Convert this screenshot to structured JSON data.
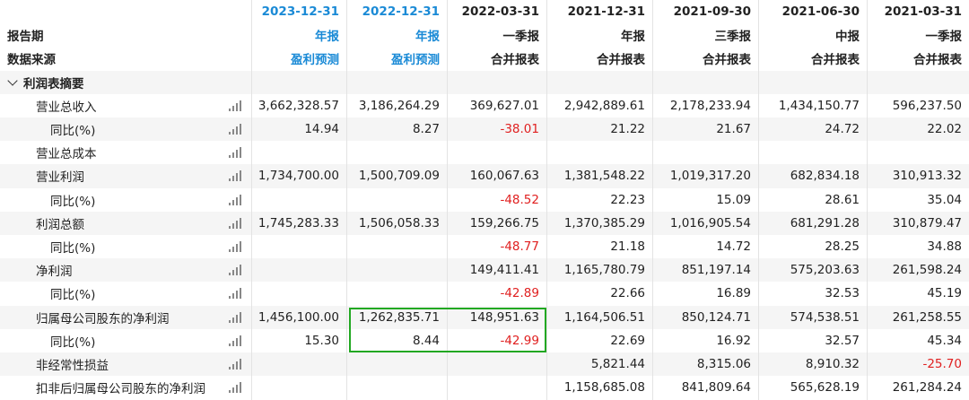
{
  "header": {
    "dates": [
      "2023-12-31",
      "2022-12-31",
      "2022-03-31",
      "2021-12-31",
      "2021-09-30",
      "2021-06-30",
      "2021-03-31"
    ],
    "report_period_label": "报告期",
    "report_types": [
      "年报",
      "年报",
      "一季报",
      "年报",
      "三季报",
      "中报",
      "一季报"
    ],
    "data_source_label": "数据来源",
    "sources": [
      "盈利预测",
      "盈利预测",
      "合并报表",
      "合并报表",
      "合并报表",
      "合并报表",
      "合并报表"
    ]
  },
  "section": {
    "title": "利润表摘要"
  },
  "rows": [
    {
      "label": "营业总收入",
      "values": [
        "3,662,328.57",
        "3,186,264.29",
        "369,627.01",
        "2,942,889.61",
        "2,178,233.94",
        "1,434,150.77",
        "596,237.50"
      ]
    },
    {
      "label": "同比(%)",
      "values": [
        "14.94",
        "8.27",
        "-38.01",
        "21.22",
        "21.67",
        "24.72",
        "22.02"
      ]
    },
    {
      "label": "营业总成本",
      "values": [
        "",
        "",
        "",
        "",
        "",
        "",
        ""
      ]
    },
    {
      "label": "营业利润",
      "values": [
        "1,734,700.00",
        "1,500,709.09",
        "160,067.63",
        "1,381,548.22",
        "1,019,317.20",
        "682,834.18",
        "310,913.32"
      ]
    },
    {
      "label": "同比(%)",
      "values": [
        "",
        "",
        "-48.52",
        "22.23",
        "15.09",
        "28.61",
        "35.04"
      ]
    },
    {
      "label": "利润总额",
      "values": [
        "1,745,283.33",
        "1,506,058.33",
        "159,266.75",
        "1,370,385.29",
        "1,016,905.54",
        "681,291.28",
        "310,879.47"
      ]
    },
    {
      "label": "同比(%)",
      "values": [
        "",
        "",
        "-48.77",
        "21.18",
        "14.72",
        "28.25",
        "34.88"
      ]
    },
    {
      "label": "净利润",
      "values": [
        "",
        "",
        "149,411.41",
        "1,165,780.79",
        "851,197.14",
        "575,203.63",
        "261,598.24"
      ]
    },
    {
      "label": "同比(%)",
      "values": [
        "",
        "",
        "-42.89",
        "22.66",
        "16.89",
        "32.53",
        "45.19"
      ]
    },
    {
      "label": "归属母公司股东的净利润",
      "values": [
        "1,456,100.00",
        "1,262,835.71",
        "148,951.63",
        "1,164,506.51",
        "850,124.71",
        "574,538.51",
        "261,258.55"
      ]
    },
    {
      "label": "同比(%)",
      "values": [
        "15.30",
        "8.44",
        "-42.99",
        "22.69",
        "16.92",
        "32.57",
        "45.34"
      ]
    },
    {
      "label": "非经常性损益",
      "values": [
        "",
        "",
        "",
        "5,821.44",
        "8,315.06",
        "8,910.32",
        "-25.70"
      ]
    },
    {
      "label": "扣非后归属母公司股东的净利润",
      "values": [
        "",
        "",
        "",
        "1,158,685.08",
        "841,809.64",
        "565,628.19",
        "261,284.24"
      ]
    }
  ],
  "colors": {
    "date_blue": "#1a8ad6",
    "negative_red": "#e02020",
    "highlight_green": "#22a822",
    "stripe": "#f5f5f5"
  },
  "icons": {
    "row_chart": "bar-chart-icon",
    "section_toggle": "chevron-down-icon"
  }
}
